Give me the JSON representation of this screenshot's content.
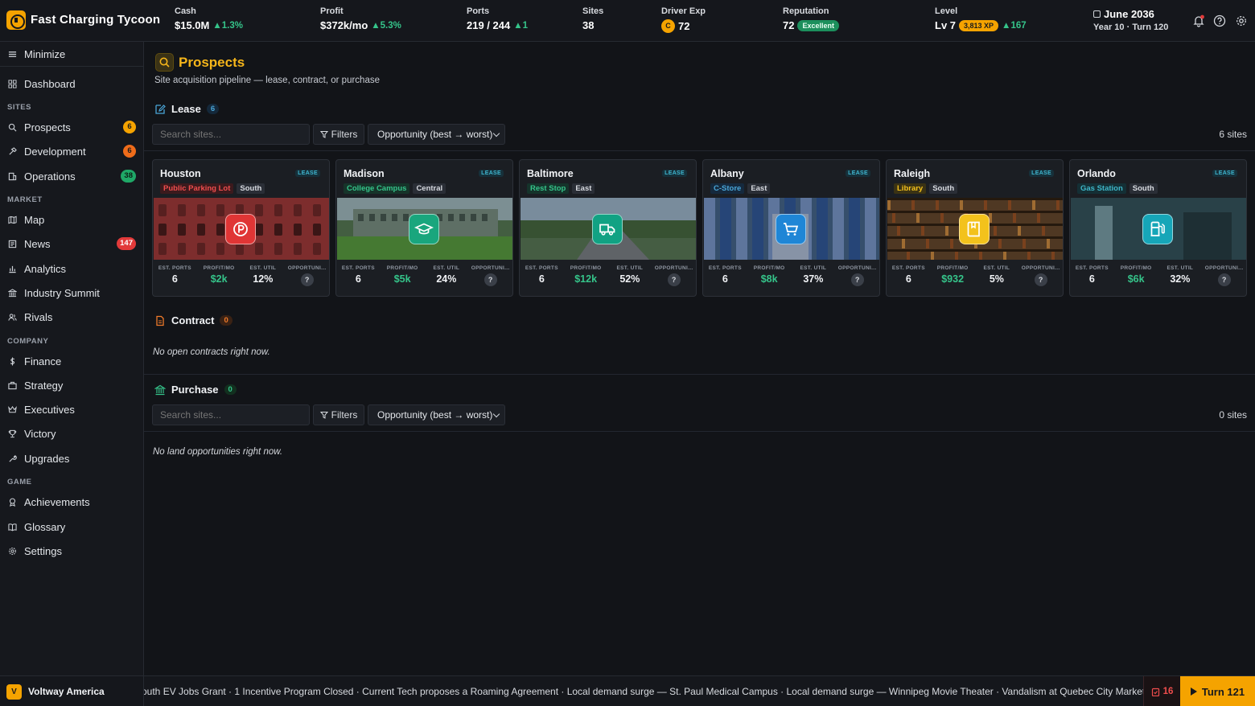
{
  "app": {
    "title": "Fast Charging Tycoon"
  },
  "header": {
    "stats": [
      {
        "label": "Cash",
        "value": "$15.0M",
        "delta": "1.3%"
      },
      {
        "label": "Profit",
        "value": "$372k/mo",
        "delta": "5.3%"
      },
      {
        "label": "Ports",
        "value": "219 / 244",
        "delta": "1"
      },
      {
        "label": "Sites",
        "value": "38"
      },
      {
        "label": "Driver Exp",
        "value": "72",
        "coin": "C"
      },
      {
        "label": "Reputation",
        "value": "72",
        "badge": "Excellent"
      },
      {
        "label": "Level",
        "value": "Lv 7",
        "badge": "3,813 XP",
        "delta": "167"
      }
    ],
    "date": "June 2036",
    "turn_info": "Year 10 · Turn 120",
    "icons": [
      "bell-icon",
      "help-icon",
      "gear-icon"
    ]
  },
  "sidebar": {
    "minimize": "Minimize",
    "dashboard": "Dashboard",
    "sections": {
      "sites": "SITES",
      "market": "MARKET",
      "company": "COMPANY",
      "game": "GAME"
    },
    "items": {
      "prospects": {
        "label": "Prospects",
        "badge": "6"
      },
      "development": {
        "label": "Development",
        "badge": "6"
      },
      "operations": {
        "label": "Operations",
        "badge": "38"
      },
      "map": {
        "label": "Map"
      },
      "news": {
        "label": "News",
        "badge": "147"
      },
      "analytics": {
        "label": "Analytics"
      },
      "summit": {
        "label": "Industry Summit"
      },
      "rivals": {
        "label": "Rivals"
      },
      "finance": {
        "label": "Finance"
      },
      "strategy": {
        "label": "Strategy"
      },
      "executives": {
        "label": "Executives"
      },
      "victory": {
        "label": "Victory"
      },
      "upgrades": {
        "label": "Upgrades"
      },
      "achievements": {
        "label": "Achievements"
      },
      "glossary": {
        "label": "Glossary"
      },
      "settings": {
        "label": "Settings"
      }
    }
  },
  "page": {
    "title": "Prospects",
    "subtitle": "Site acquisition pipeline — lease, contract, or purchase"
  },
  "lease": {
    "title": "Lease",
    "count": "6",
    "search_placeholder": "Search sites...",
    "filters_label": "Filters",
    "sort_label": "Opportunity (best → worst)",
    "site_count": "6 sites",
    "tag_label": "LEASE",
    "metric_labels": [
      "EST. PORTS",
      "PROFIT/MO",
      "EST. UTIL",
      "OPPORTUNI..."
    ],
    "cards": [
      {
        "city": "Houston",
        "type": "Public Parking Lot",
        "region": "South",
        "ports": "6",
        "profit": "$2k",
        "util": "12%",
        "opportunity": "?",
        "color": "#e03535",
        "icon": "parking-icon"
      },
      {
        "city": "Madison",
        "type": "College Campus",
        "region": "Central",
        "ports": "6",
        "profit": "$5k",
        "util": "24%",
        "opportunity": "?",
        "color": "#19a67d",
        "icon": "graduation-cap-icon"
      },
      {
        "city": "Baltimore",
        "type": "Rest Stop",
        "region": "East",
        "ports": "6",
        "profit": "$12k",
        "util": "52%",
        "opportunity": "?",
        "color": "#11a283",
        "icon": "truck-icon"
      },
      {
        "city": "Albany",
        "type": "C-Store",
        "region": "East",
        "ports": "6",
        "profit": "$8k",
        "util": "37%",
        "opportunity": "?",
        "color": "#1f86d6",
        "icon": "shopping-cart-icon"
      },
      {
        "city": "Raleigh",
        "type": "Library",
        "region": "South",
        "ports": "6",
        "profit": "$932",
        "util": "5%",
        "opportunity": "?",
        "color": "#f3c21c",
        "icon": "book-icon"
      },
      {
        "city": "Orlando",
        "type": "Gas Station",
        "region": "South",
        "ports": "6",
        "profit": "$6k",
        "util": "32%",
        "opportunity": "?",
        "color": "#16a6b8",
        "icon": "fuel-pump-icon"
      }
    ]
  },
  "contract": {
    "title": "Contract",
    "count": "0",
    "empty": "No open contracts right now."
  },
  "purchase": {
    "title": "Purchase",
    "count": "0",
    "search_placeholder": "Search sites...",
    "filters_label": "Filters",
    "sort_label": "Opportunity (best → worst)",
    "site_count": "0 sites",
    "empty": "No land opportunities right now."
  },
  "footer": {
    "company_initial": "V",
    "company_name": "Voltway America",
    "ticker": "outh EV Jobs Grant · 1 Incentive Program Closed · Current Tech proposes a Roaming Agreement · Local demand surge — St. Paul Medical Campus · Local demand surge — Winnipeg Movie Theater · Vandalism at Quebec City Market · Charger offline a",
    "alerts": "16",
    "turn_button": "Turn 121"
  },
  "colors": {
    "accent": "#f5a300",
    "positive": "#35c48a",
    "danger": "#e23a3a"
  }
}
